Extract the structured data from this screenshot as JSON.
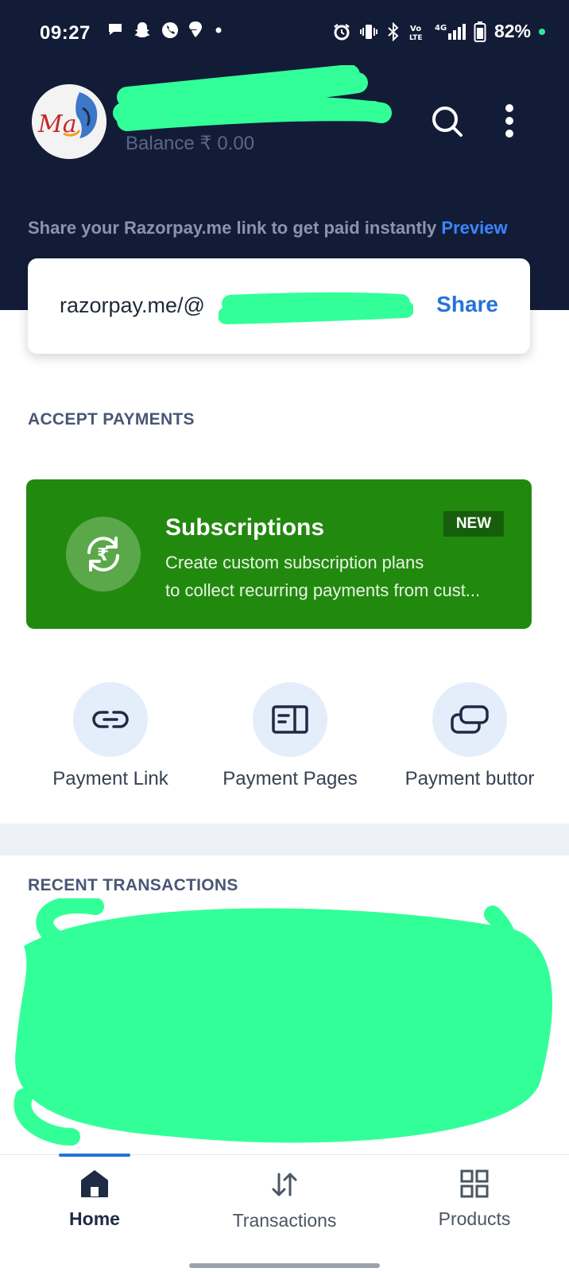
{
  "status_bar": {
    "time": "09:27",
    "battery": "82%"
  },
  "header": {
    "balance": "Balance ₹ 0.00",
    "share_hint": "Share your Razorpay.me link to get paid instantly",
    "preview_label": "Preview"
  },
  "link_card": {
    "link_text": "razorpay.me/@",
    "share_label": "Share"
  },
  "accept_payments": {
    "title": "ACCEPT PAYMENTS",
    "subscription": {
      "title": "Subscriptions",
      "badge": "NEW",
      "line1": "Create custom subscription plans",
      "line2": "to collect recurring payments from cust..."
    },
    "quick_actions": [
      {
        "label": "Payment Link",
        "icon": "link-icon"
      },
      {
        "label": "Payment Pages",
        "icon": "page-icon"
      },
      {
        "label": "Payment buttor",
        "icon": "button-icon"
      }
    ]
  },
  "recent_transactions": {
    "title": "RECENT TRANSACTIONS"
  },
  "bottom_nav": {
    "items": [
      {
        "label": "Home",
        "icon": "home-icon",
        "active": true
      },
      {
        "label": "Transactions",
        "icon": "transfer-arrows-icon",
        "active": false
      },
      {
        "label": "Products",
        "icon": "grid-icon",
        "active": false
      }
    ]
  },
  "colors": {
    "header_bg": "#131c37",
    "accent_blue": "#2573d9",
    "subscription_green": "#22890f",
    "redaction_green": "#33ff99"
  }
}
